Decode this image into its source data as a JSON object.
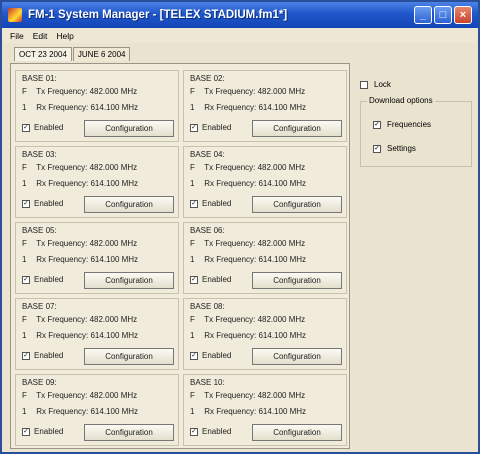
{
  "window": {
    "title": "FM-1 System Manager - [TELEX STADIUM.fm1*]"
  },
  "menu": [
    "File",
    "Edit",
    "Help"
  ],
  "tabs": [
    "OCT 23 2004",
    "JUNE 6 2004"
  ],
  "common": {
    "tx_code": "F",
    "rx_code": "1",
    "enabled_label": "Enabled",
    "config_label": "Configuration",
    "check": "✓"
  },
  "bases": [
    {
      "name": "BASE 01:",
      "tx": "Tx Frequency: 482.000 MHz",
      "rx": "Rx Frequency: 614.100 MHz"
    },
    {
      "name": "BASE 02:",
      "tx": "Tx Frequency: 482.000 MHz",
      "rx": "Rx Frequency: 614.100 MHz"
    },
    {
      "name": "BASE 03:",
      "tx": "Tx Frequency: 482.000 MHz",
      "rx": "Rx Frequency: 614.100 MHz"
    },
    {
      "name": "BASE 04:",
      "tx": "Tx Frequency: 482.000 MHz",
      "rx": "Rx Frequency: 614.100 MHz"
    },
    {
      "name": "BASE 05:",
      "tx": "Tx Frequency: 482.000 MHz",
      "rx": "Rx Frequency: 614.100 MHz"
    },
    {
      "name": "BASE 06:",
      "tx": "Tx Frequency: 482.000 MHz",
      "rx": "Rx Frequency: 614.100 MHz"
    },
    {
      "name": "BASE 07:",
      "tx": "Tx Frequency: 482.000 MHz",
      "rx": "Rx Frequency: 614.100 MHz"
    },
    {
      "name": "BASE 08:",
      "tx": "Tx Frequency: 482.000 MHz",
      "rx": "Rx Frequency: 614.100 MHz"
    },
    {
      "name": "BASE 09:",
      "tx": "Tx Frequency: 482.000 MHz",
      "rx": "Rx Frequency: 614.100 MHz"
    },
    {
      "name": "BASE 10:",
      "tx": "Tx Frequency: 482.000 MHz",
      "rx": "Rx Frequency: 614.100 MHz"
    }
  ],
  "right": {
    "lock_label": "Lock",
    "download_title": "Download options",
    "frequencies_label": "Frequencies",
    "settings_label": "Settings"
  }
}
